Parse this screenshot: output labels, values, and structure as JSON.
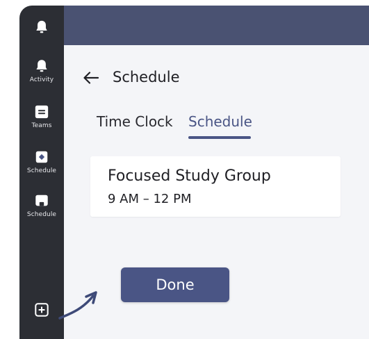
{
  "sidebar": {
    "items": [
      {
        "label": "",
        "icon": "bell-icon"
      },
      {
        "label": "Activity",
        "icon": "bell-icon"
      },
      {
        "label": "Teams",
        "icon": "teams-icon"
      },
      {
        "label": "Schedule",
        "icon": "schedule-diamond-icon"
      },
      {
        "label": "Schedule",
        "icon": "schedule-tray-icon"
      }
    ],
    "add_icon": "add-app-icon"
  },
  "header": {
    "title": "Schedule",
    "back_icon": "arrow-left-icon"
  },
  "tabs": [
    {
      "label": "Time Clock",
      "active": false
    },
    {
      "label": "Schedule",
      "active": true
    }
  ],
  "shift": {
    "title": "Focused Study Group",
    "time": "9 AM – 12 PM"
  },
  "done_label": "Done",
  "colors": {
    "sidebar_bg": "#2c2e34",
    "topbar_bg": "#4a5272",
    "accent": "#4a5585",
    "content_bg": "#f4f5f8",
    "card_bg": "#ffffff"
  }
}
